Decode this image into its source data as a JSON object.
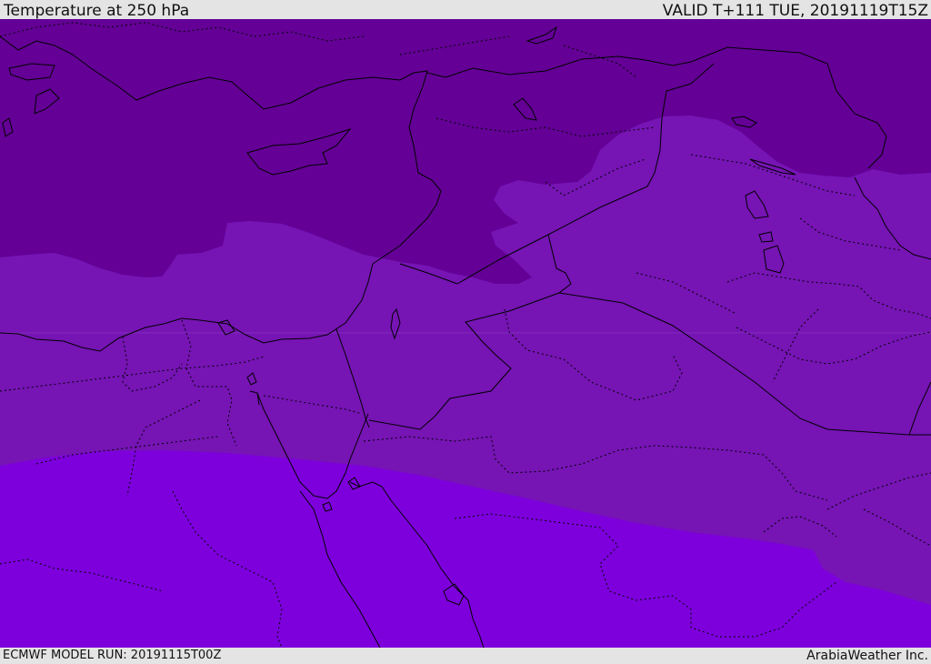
{
  "header": {
    "title": "Temperature at 250 hPa",
    "valid_time": "VALID T+111 TUE, 20191119T15Z"
  },
  "footer": {
    "model_run": "ECMWF MODEL RUN: 20191115T00Z",
    "credit": "ArabiaWeather Inc."
  },
  "map": {
    "fill_colors": {
      "coldest_band": "#640096",
      "middle_band": "#7614b4",
      "warmest_band": "#7d00dc"
    },
    "border_color": "#000000"
  }
}
